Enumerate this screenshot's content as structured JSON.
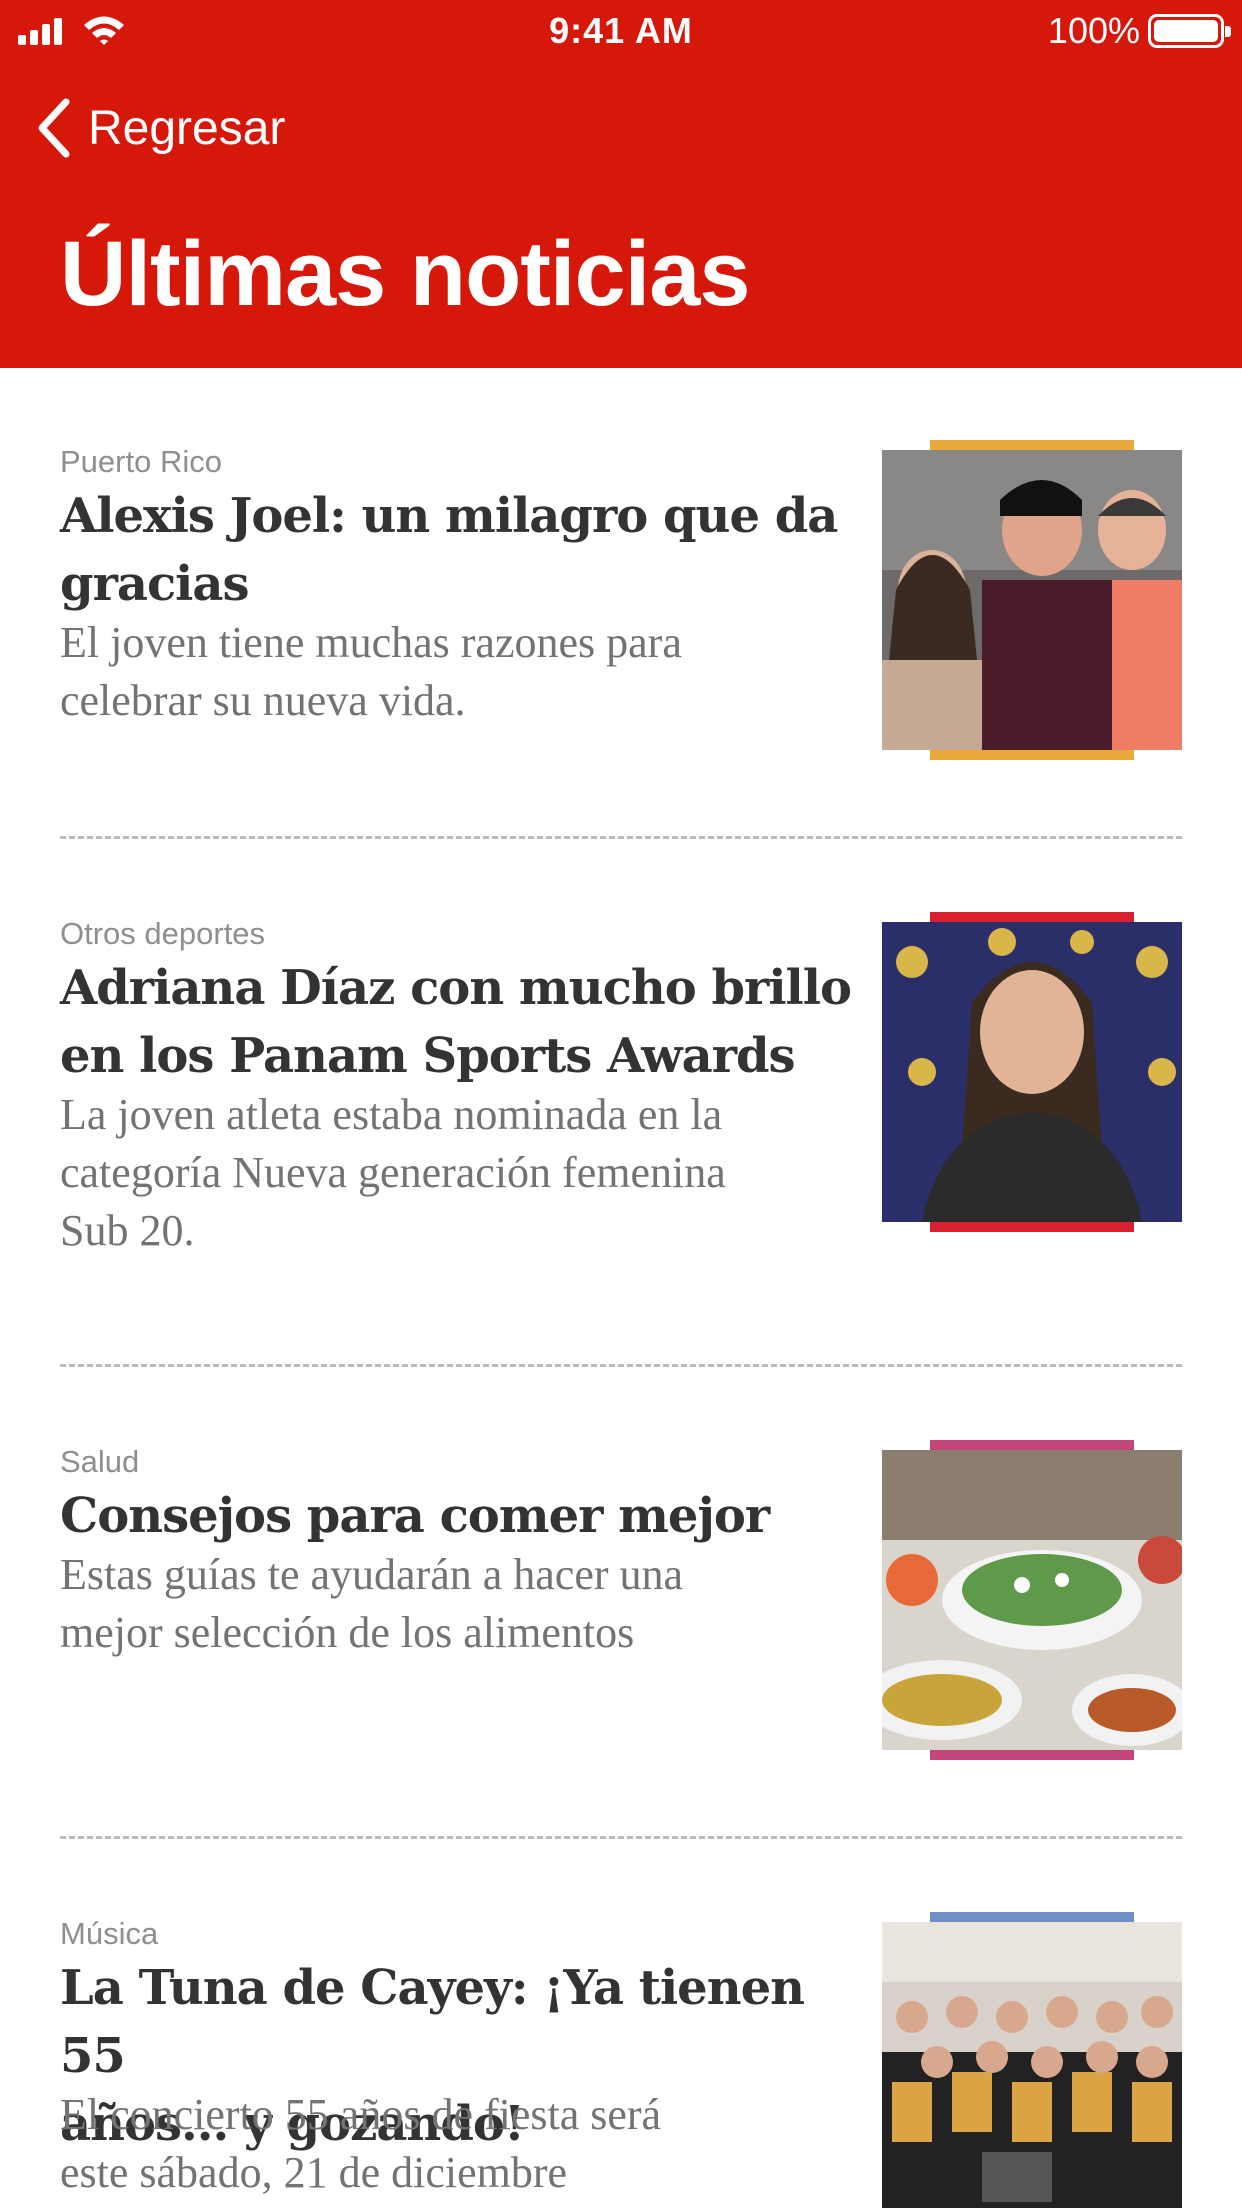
{
  "status_bar": {
    "time": "9:41 AM",
    "battery": "100%"
  },
  "nav": {
    "back_label": "Regresar"
  },
  "page_title": "Últimas noticias",
  "colors": {
    "header_bg": "#d6180b"
  },
  "articles": [
    {
      "category": "Puerto Rico",
      "headline_line1": "Alexis Joel: un milagro que da",
      "headline_line2": "gracias",
      "summary_line1": "El joven tiene muchas razones para",
      "summary_line2": "celebrar su nueva vida.",
      "summary_line3": "",
      "accent_color": "#e8a83a"
    },
    {
      "category": "Otros deportes",
      "headline_line1": "Adriana Díaz con mucho brillo",
      "headline_line2": "en los Panam Sports Awards",
      "summary_line1": "La joven atleta estaba nominada en la",
      "summary_line2": "categoría Nueva generación femenina",
      "summary_line3": "Sub 20.",
      "accent_color": "#d8202e"
    },
    {
      "category": "Salud",
      "headline_line1": "Consejos para comer mejor",
      "headline_line2": "",
      "summary_line1": "Estas guías te ayudarán a hacer una",
      "summary_line2": "mejor selección de los alimentos",
      "summary_line3": "",
      "accent_color": "#c2457c"
    },
    {
      "category": "Música",
      "headline_line1": "La Tuna de Cayey: ¡Ya tienen 55",
      "headline_line2": "años... y gozando!",
      "summary_line1": "El concierto 55 años de fiesta será",
      "summary_line2": "este sábado, 21 de diciembre",
      "summary_line3": "",
      "accent_color": "#6f8fc8"
    }
  ]
}
